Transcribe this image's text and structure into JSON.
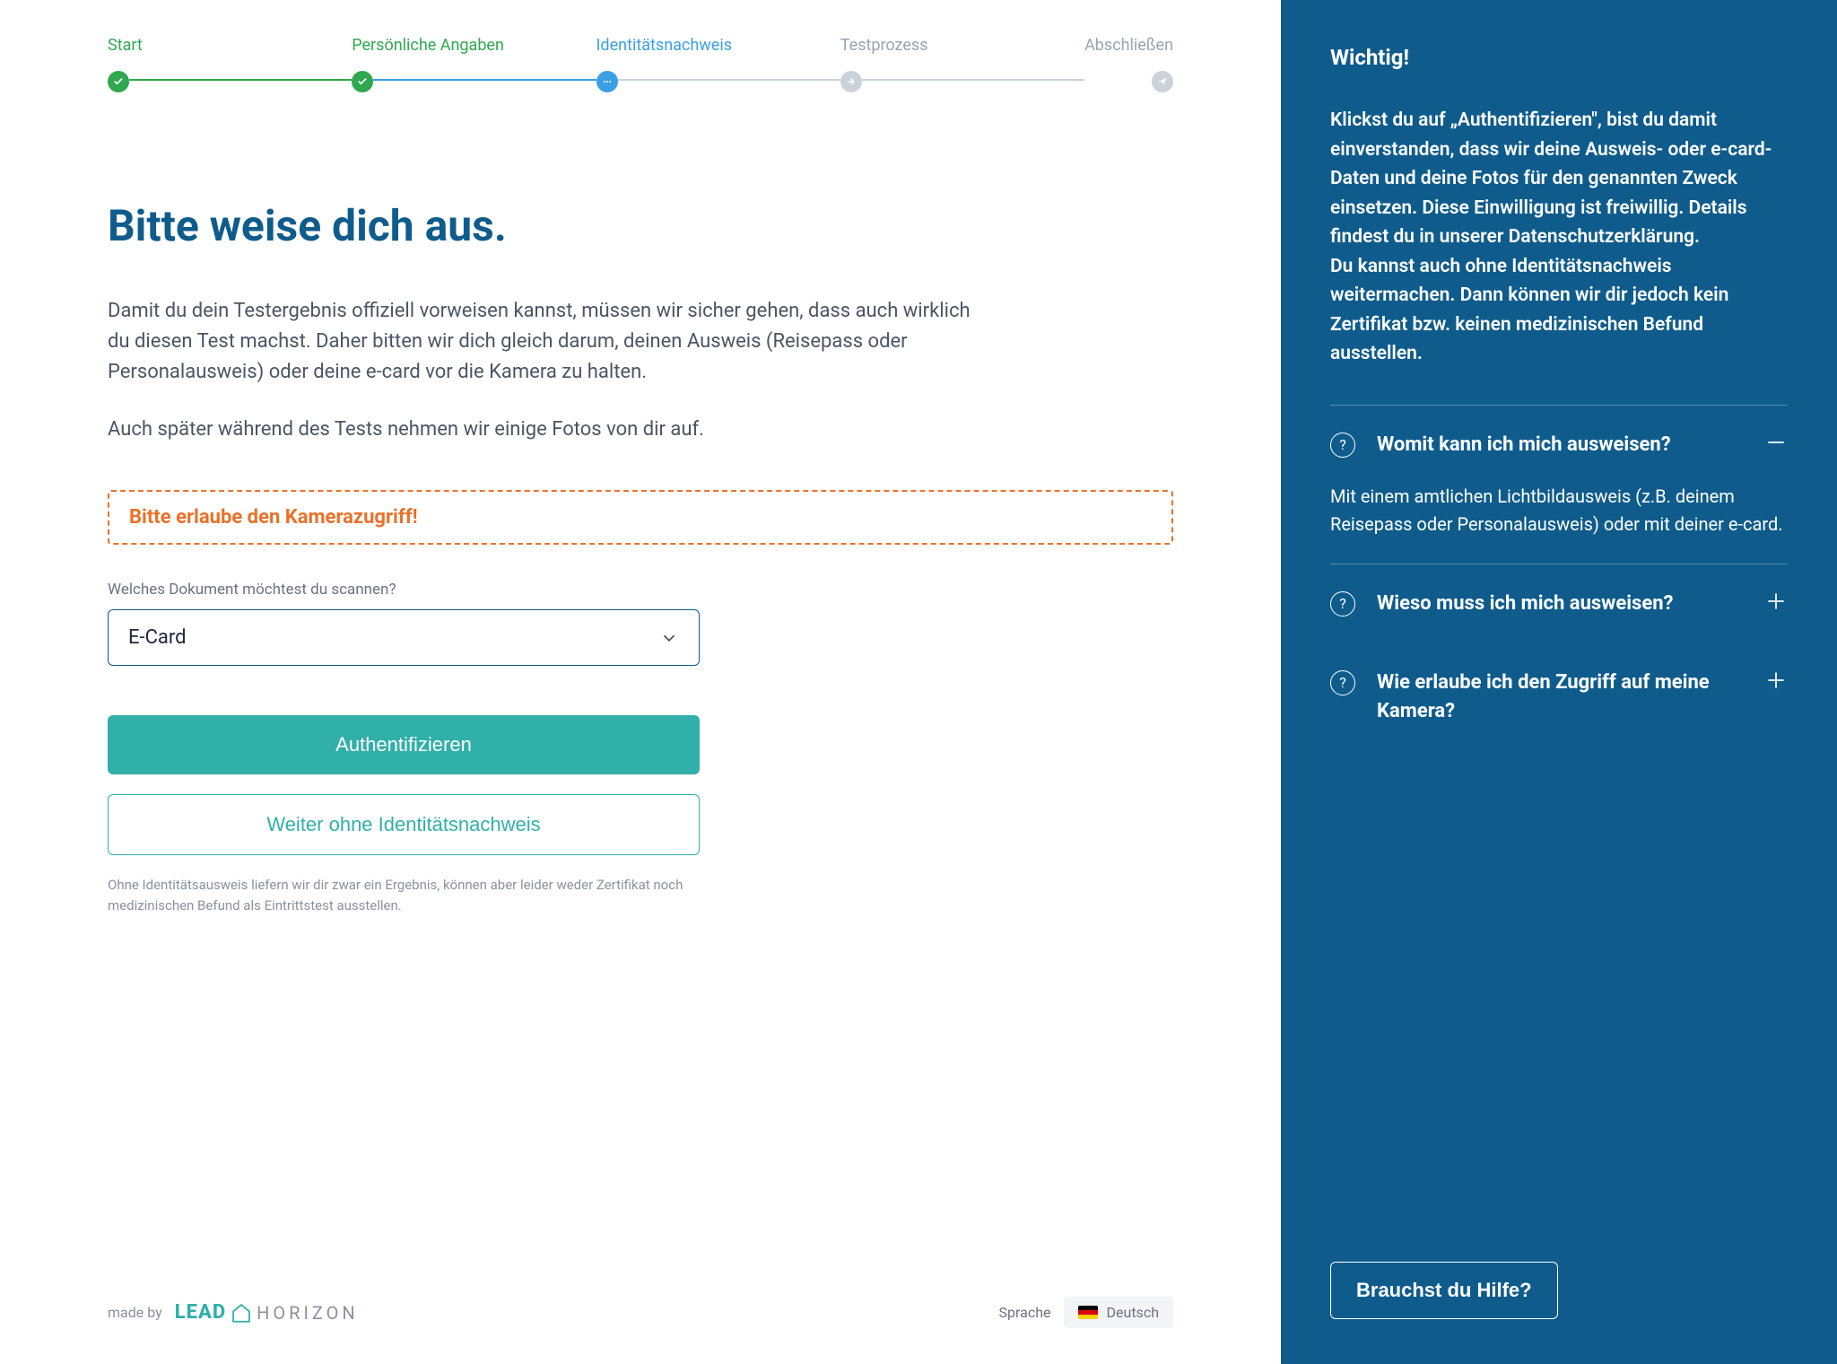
{
  "stepper": {
    "steps": [
      {
        "label": "Start",
        "state": "done"
      },
      {
        "label": "Persönliche Angaben",
        "state": "done"
      },
      {
        "label": "Identitätsnachweis",
        "state": "active"
      },
      {
        "label": "Testprozess",
        "state": "pending"
      },
      {
        "label": "Abschließen",
        "state": "pending"
      }
    ]
  },
  "main": {
    "title": "Bitte weise dich aus.",
    "para1": "Damit du dein Testergebnis offiziell vorweisen kannst, müssen wir sicher gehen, dass auch wirklich du diesen Test machst. Daher bitten wir dich gleich darum, deinen Ausweis (Reisepass oder Personalausweis) oder deine e-card vor die Kamera zu halten.",
    "para2": "Auch später während des Tests nehmen wir einige Fotos von dir auf.",
    "camera_warning": "Bitte erlaube den Kamerazugriff!",
    "doc_label": "Welches Dokument möchtest du scannen?",
    "doc_selected": "E-Card",
    "btn_primary": "Authentifizieren",
    "btn_secondary": "Weiter ohne Identitätsnachweis",
    "note": "Ohne Identitätsausweis liefern wir dir zwar ein Ergebnis, können aber leider weder Zertifikat noch medizinischen Befund als Eintrittstest ausstellen."
  },
  "footer": {
    "made_by": "made by",
    "brand_lead": "LEAD",
    "brand_horizon": "HORIZON",
    "lang_label": "Sprache",
    "lang_value": "Deutsch"
  },
  "sidebar": {
    "heading": "Wichtig!",
    "info": "Klickst du auf „Authentifizieren\", bist du damit einverstanden, dass wir deine Ausweis- oder e-card-Daten und deine Fotos für den genannten Zweck einsetzen. Diese Einwilligung ist freiwillig. Details findest du in unserer Datenschutzerklärung.\nDu kannst auch ohne Identitätsnachweis weitermachen. Dann können wir dir jedoch kein Zertifikat bzw. keinen medizinischen Befund ausstellen.",
    "faq": [
      {
        "q": "Womit kann ich mich ausweisen?",
        "a": "Mit einem amtlichen Lichtbildausweis (z.B. deinem Reisepass oder Personalausweis) oder mit deiner e-card.",
        "open": true
      },
      {
        "q": "Wieso muss ich mich ausweisen?",
        "open": false
      },
      {
        "q": "Wie erlaube ich den Zugriff auf meine Kamera?",
        "open": false
      }
    ],
    "help_btn": "Brauchst du Hilfe?"
  }
}
